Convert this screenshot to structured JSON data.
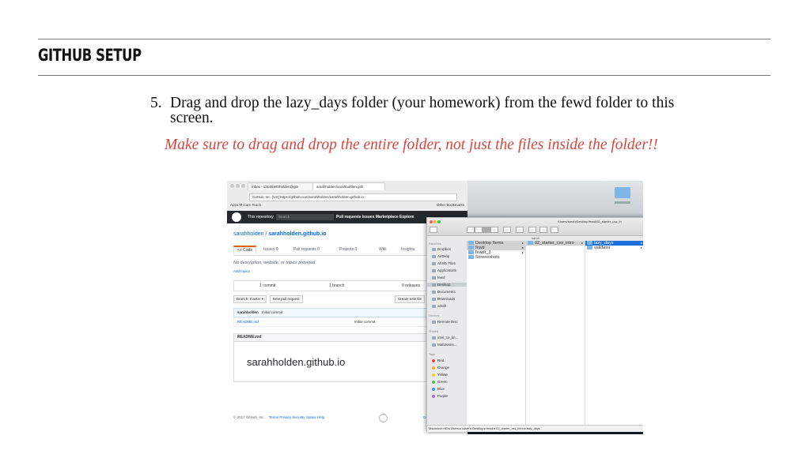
{
  "slide": {
    "title": "GITHUB SETUP",
    "step_number": "5.",
    "step_text": "Drag and drop the lazy_days folder (your homework) from the fewd folder to this screen.",
    "note": "Make sure to drag and drop the entire folder, not just the files inside the folder!!"
  },
  "browser": {
    "tab1": "Inbox - sarahbethholden@gm",
    "tab2": "sarahholden/sarahholden.gith",
    "address": "GitHub, Inc. [US]  https://github.com/sarahholden/sarahholden.github.io",
    "bookmarks": "Apps   M   Cars   Teach",
    "other_bookmarks": "Other Bookmarks"
  },
  "github": {
    "this_repository": "This repository",
    "search_placeholder": "Search",
    "nav": "Pull requests   Issues   Marketplace   Explore",
    "owner": "sarahholden",
    "separator": " / ",
    "repo_name": "sarahholden.github.io",
    "tabs": [
      "<> Code",
      "Issues 0",
      "Pull requests 0",
      "Projects 0",
      "Wiki",
      "Insights"
    ],
    "description": "No description, website, or topics provided.",
    "add_topics": "Add topics",
    "commits": "1 commit",
    "branches": "1 branch",
    "releases": "0 releases",
    "branch_button": "Branch: master ▾",
    "new_pr_button": "New pull request",
    "create_file_button": "Create new file",
    "commit_author": "sarahholden",
    "commit_message": "Initial commit",
    "file_name": "README.md",
    "file_commit": "Initial commit",
    "readme_header": "README.md",
    "readme_title": "sarahholden.github.io",
    "footer_copyright": "© 2017 GitHub, Inc.",
    "footer_links": "Terms   Privacy   Security   Status   Help",
    "footer_right": "Contact GitHub   API   Tr"
  },
  "finder": {
    "path": "/Users/sarah/Desktop/fewd/02_starter_css_in",
    "window_label": "sarah",
    "favorites_header": "Favorites",
    "favorites": [
      "Dropbox",
      "AirDrop",
      "All My Files",
      "Applications",
      "fewd",
      "Desktop",
      "Documents",
      "Downloads",
      "sarah"
    ],
    "devices_header": "Devices",
    "devices": [
      "Remote Disc"
    ],
    "shared_header": "Shared",
    "shared": [
      "intel_ce_lin...",
      "MattJones..."
    ],
    "tags_header": "Tags",
    "tags": [
      {
        "name": "Red",
        "color": "#f04848"
      },
      {
        "name": "Orange",
        "color": "#f5a623"
      },
      {
        "name": "Yellow",
        "color": "#f0d030"
      },
      {
        "name": "Green",
        "color": "#4cc04c"
      },
      {
        "name": "Blue",
        "color": "#3a8ef0"
      },
      {
        "name": "Purple",
        "color": "#b06ad8"
      }
    ],
    "column1": [
      "Desktop Items",
      "fewd",
      "fewdr_3",
      "Screenshots"
    ],
    "column2": [
      "02_starter_css_intro"
    ],
    "column3": [
      "lazy_days",
      "validator"
    ],
    "status_path": "Macintosh HD ▸ Users ▸ sarah ▸ Desktop ▸ fewd ▸ 02_starter_css_intro ▸ lazy_days"
  },
  "colors": {
    "note": "#d9453d",
    "github_bar": "#24292e",
    "finder_selection": "#1d6fe0",
    "link": "#0366d6"
  }
}
